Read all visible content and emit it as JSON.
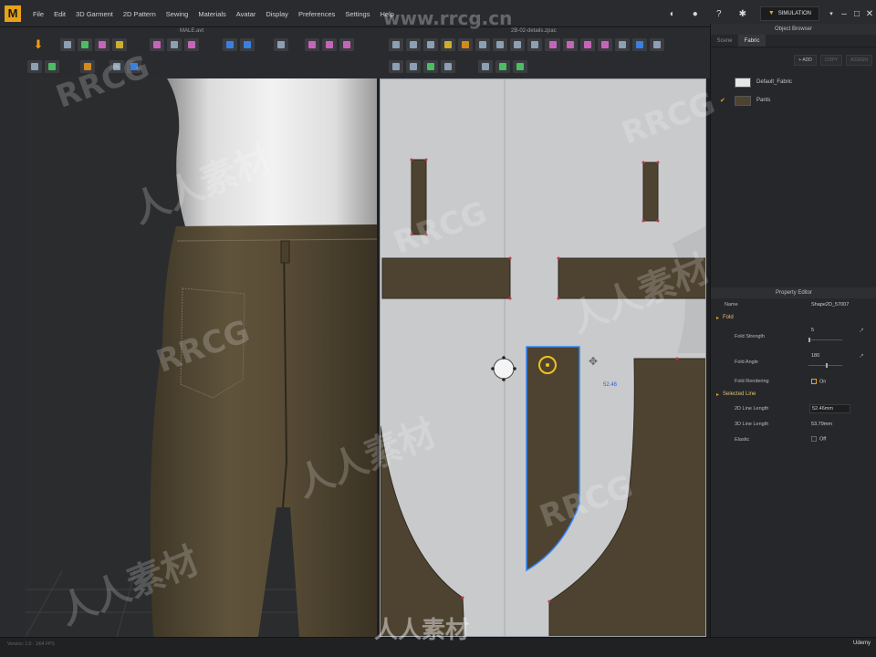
{
  "app": {
    "logo": "M",
    "menus": [
      "File",
      "Edit",
      "3D Garment",
      "2D Pattern",
      "Sewing",
      "Materials",
      "Avatar",
      "Display",
      "Preferences",
      "Settings",
      "Help"
    ],
    "mode_button": "SIMULATION",
    "avatar_file": "MALE.avt",
    "project_file": "2B-02-details.zpac"
  },
  "object_browser": {
    "title": "Object Browser",
    "tabs": [
      "Scene",
      "Fabric"
    ],
    "active_tab": "Fabric",
    "actions": [
      "+ ADD",
      "COPY",
      "ASSIGN"
    ],
    "fabrics": [
      {
        "name": "Default_Fabric",
        "color": "#e6e6e6",
        "checked": false
      },
      {
        "name": "Pants",
        "color": "#4e4330",
        "checked": true
      }
    ]
  },
  "property_editor": {
    "title": "Property Editor",
    "name_label": "Name",
    "name_value": "Shape2D_57007",
    "fold_section": "Fold",
    "fold_strength_label": "Fold Strength",
    "fold_strength_value": "5",
    "fold_angle_label": "Fold Angle",
    "fold_angle_value": "180",
    "fold_rendering_label": "Fold Rendering",
    "fold_rendering_value": "On",
    "selected_line_section": "Selected Line",
    "line_length_2d_label": "2D Line Length",
    "line_length_2d_value": "52.46mm",
    "line_length_3d_label": "3D Line Length",
    "line_length_3d_value": "53.79mm",
    "elastic_label": "Elastic",
    "elastic_value": "Off"
  },
  "pattern_view": {
    "measure_label": "52.46"
  },
  "status": {
    "left_text": "Version: 1.0  ·  1/64 FPS",
    "udemy": "Udemy"
  },
  "watermarks": {
    "cn": "人人素材",
    "latin": "RRCG",
    "url": "www.rrcg.cn"
  },
  "colors": {
    "accent": "#e8a21a",
    "pants_fabric": "#4e4330",
    "pattern_bg": "#c9cacc",
    "selection": "#2f86ff"
  }
}
